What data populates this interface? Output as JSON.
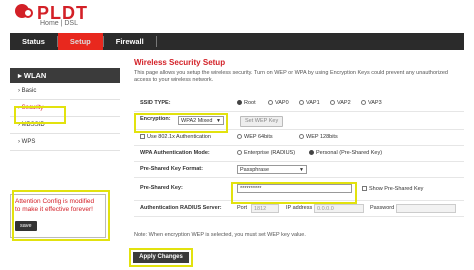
{
  "brand": {
    "name": "PLDT",
    "subtitle": "Home | DSL"
  },
  "nav": {
    "tabs": [
      "Status",
      "Setup",
      "Firewall"
    ],
    "active": "Setup"
  },
  "sidebar": {
    "title": "WLAN",
    "items": [
      "Basic",
      "Security",
      "MBSSID",
      "WPS"
    ],
    "active": "Security"
  },
  "attention": {
    "text": "Attention Config is modified to make it effective forever!",
    "save_label": "save"
  },
  "main": {
    "title": "Wireless Security Setup",
    "description": "This page allows you setup the wireless security. Turn on WEP or WPA by using Encryption Keys could prevent any unauthorized access to your wireless network."
  },
  "form": {
    "ssid_type_label": "SSID TYPE:",
    "ssid_options": [
      "Root",
      "VAP0",
      "VAP1",
      "VAP2",
      "VAP3"
    ],
    "ssid_selected": "Root",
    "encryption_label": "Encryption:",
    "encryption_value": "WPA2 Mixed",
    "set_wep_key_label": "Set WEP Key",
    "use_8021x_label": "Use 802.1x Authentication",
    "wep_64_label": "WEP 64bits",
    "wep_128_label": "WEP 128bits",
    "wpa_auth_label": "WPA Authentication Mode:",
    "wpa_auth_options": [
      "Enterprise (RADIUS)",
      "Personal (Pre-Shared Key)"
    ],
    "wpa_auth_selected": "Personal (Pre-Shared Key)",
    "psk_format_label": "Pre-Shared Key Format:",
    "psk_format_value": "Passphrase",
    "psk_label": "Pre-Shared Key:",
    "psk_value": "**********",
    "show_psk_label": "Show Pre-Shared Key",
    "radius_label": "Authentication RADIUS Server:",
    "port_label": "Port",
    "port_value": "1812",
    "ip_label": "IP address",
    "ip_value": "0.0.0.0",
    "password_label": "Password"
  },
  "note": "Note: When encryption WEP is selected, you must set WEP key value.",
  "apply_label": "Apply Changes",
  "colors": {
    "brand_red": "#d32027",
    "nav_dark": "#2b2b2b",
    "highlight": "#e2e20e"
  }
}
